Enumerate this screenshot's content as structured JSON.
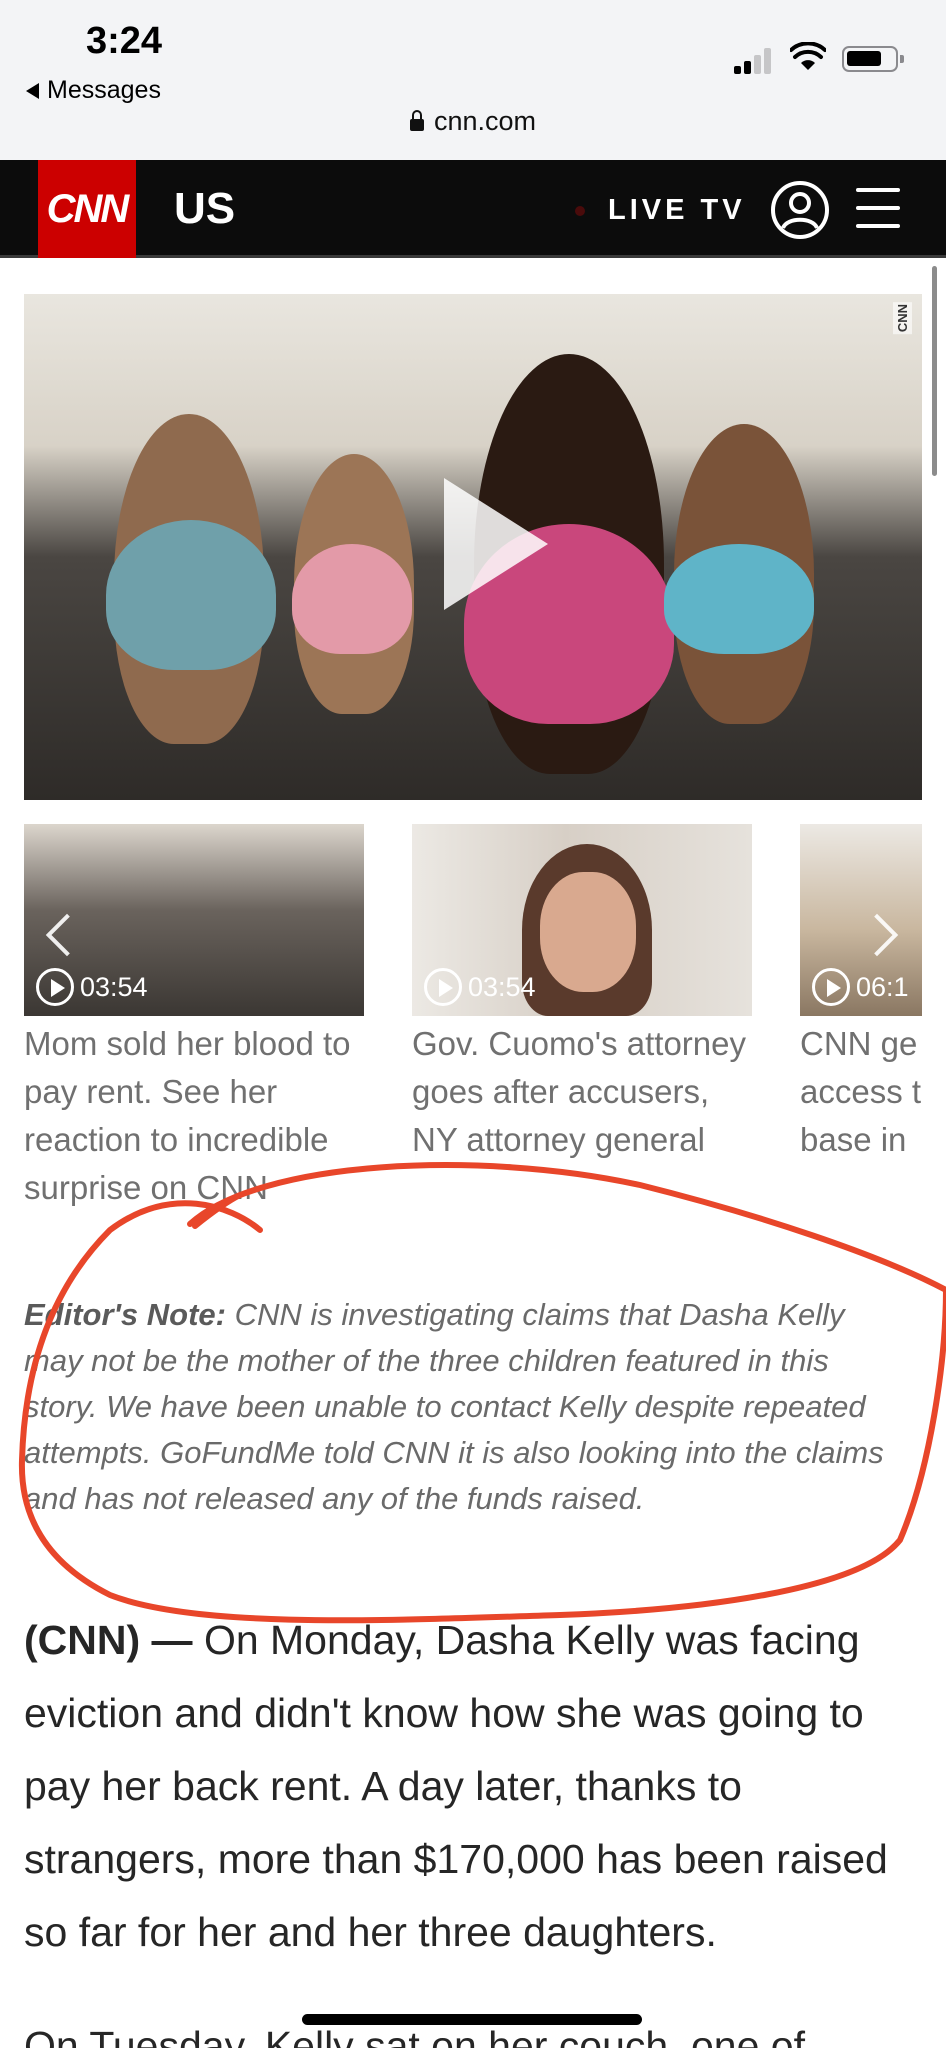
{
  "status_bar": {
    "time": "3:24",
    "back_label": "Messages",
    "signal_bars_active": 2,
    "signal_bars_total": 4,
    "battery_level": 0.7
  },
  "browser": {
    "url": "cnn.com",
    "lock_icon": "lock-icon"
  },
  "header": {
    "logo": "CNN",
    "section": "US",
    "live_tv": "LIVE TV",
    "icons": [
      "account-icon",
      "hamburger-menu-icon"
    ],
    "brand_color": "#cc0000"
  },
  "video": {
    "bug": "CNN",
    "play_icon": "play-icon"
  },
  "carousel": [
    {
      "duration": "03:54",
      "caption": "Mom sold her blood to pay rent. See her reaction to incredible surprise on CNN"
    },
    {
      "duration": "03:54",
      "caption": "Gov. Cuomo's attorney goes after accusers, NY attorney general"
    },
    {
      "duration": "06:1",
      "caption_lines": [
        "CNN ge",
        "access t",
        "base in"
      ]
    }
  ],
  "editors_note": {
    "label": "Editor's Note:",
    "text": "CNN is investigating claims that Dasha Kelly may not be the mother of the three children featured in this story. We have been unable to contact Kelly despite repeated attempts. GoFundMe told CNN it is also looking into the claims and has not released any of the funds raised."
  },
  "article": {
    "dateline": "(CNN) —",
    "paragraph_1": "On Monday, Dasha Kelly was facing eviction and didn't know how she was going to pay her back rent. A day later, thanks to strangers, more than $170,000 has been raised so far for her and her three daughters.",
    "paragraph_2_start": "On Tuesday, Kelly sat on her couch, one of"
  },
  "annotation_color": "#e8462a"
}
